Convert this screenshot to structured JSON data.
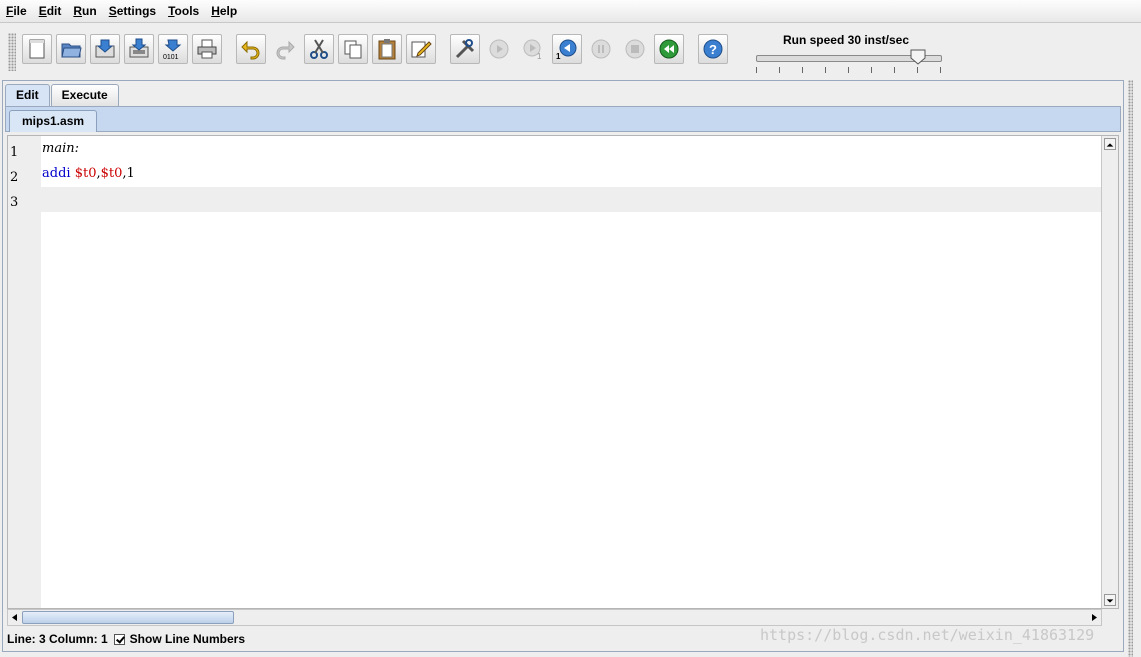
{
  "menu": [
    {
      "label": "File",
      "mn": "F",
      "rest": "ile"
    },
    {
      "label": "Edit",
      "mn": "E",
      "rest": "dit"
    },
    {
      "label": "Run",
      "mn": "R",
      "rest": "un"
    },
    {
      "label": "Settings",
      "mn": "S",
      "rest": "ettings"
    },
    {
      "label": "Tools",
      "mn": "T",
      "rest": "ools"
    },
    {
      "label": "Help",
      "mn": "H",
      "rest": "elp"
    }
  ],
  "toolbar": {
    "run_speed_label": "Run speed 30 inst/sec",
    "run_speed_fraction": 0.88,
    "step_digit": "1",
    "binary_label": "0101"
  },
  "tabs": {
    "edit": "Edit",
    "execute": "Execute",
    "active": "Edit"
  },
  "file_tab": "mips1.asm",
  "editor": {
    "line_numbers": [
      "1",
      "2",
      "3"
    ],
    "line1": "main:",
    "line2_op": "addi",
    "line2_reg1": "$t0",
    "line2_comma1": ",",
    "line2_reg2": "$t0",
    "line2_comma2": ",",
    "line2_imm": "1"
  },
  "status": {
    "cursor": "Line: 3 Column: 1",
    "show_line_numbers": "Show Line Numbers",
    "show_line_numbers_checked": true
  },
  "watermark": "https://blog.csdn.net/weixin_41863129",
  "colors": {
    "keyword": "#0000cc",
    "register": "#cc0000",
    "tab_strip": "#c5d8ef"
  }
}
